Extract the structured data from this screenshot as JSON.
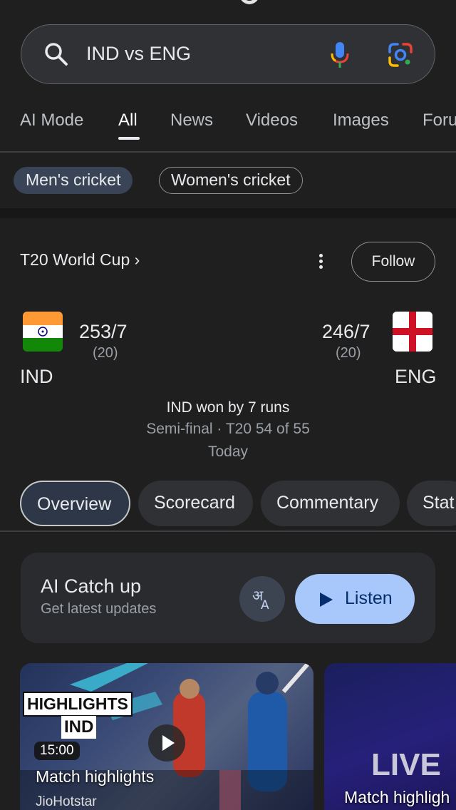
{
  "search": {
    "query": "IND vs ENG",
    "icons": [
      "search-icon",
      "mic-icon",
      "lens-icon"
    ]
  },
  "tabs": [
    {
      "label": "AI Mode",
      "active": false
    },
    {
      "label": "All",
      "active": true
    },
    {
      "label": "News",
      "active": false
    },
    {
      "label": "Videos",
      "active": false
    },
    {
      "label": "Images",
      "active": false
    },
    {
      "label": "Foru",
      "active": false
    }
  ],
  "chips": [
    {
      "label": "Men's cricket",
      "selected": true
    },
    {
      "label": "Women's cricket",
      "selected": false
    }
  ],
  "match_card": {
    "tournament": "T20 World Cup ›",
    "follow_label": "Follow",
    "team1": {
      "name": "IND",
      "score": "253/7",
      "overs": "(20)",
      "flag": "india-flag"
    },
    "team2": {
      "name": "ENG",
      "score": "246/7",
      "overs": "(20)",
      "flag": "england-flag"
    },
    "result": "IND won by 7 runs",
    "stage": "Semi-final · T20 54 of 55",
    "date": "Today",
    "pills": [
      {
        "label": "Overview",
        "active": true
      },
      {
        "label": "Scorecard",
        "active": false
      },
      {
        "label": "Commentary",
        "active": false
      },
      {
        "label": "Stat",
        "active": false
      }
    ]
  },
  "catchup": {
    "title": "AI Catch up",
    "subtitle": "Get latest updates",
    "translate_icon": "translate-icon",
    "listen_label": "Listen"
  },
  "videos": [
    {
      "badge1": "HIGHLIGHTS",
      "badge2": "IND",
      "duration": "15:00",
      "title": "Match highlights",
      "source": "JioHotstar"
    },
    {
      "overlay": "LIVE",
      "title": "Match highligh"
    }
  ],
  "colors": {
    "background": "#1f1f1f",
    "listen_button": "#a8c7fa",
    "selected_chip": "#394457"
  }
}
